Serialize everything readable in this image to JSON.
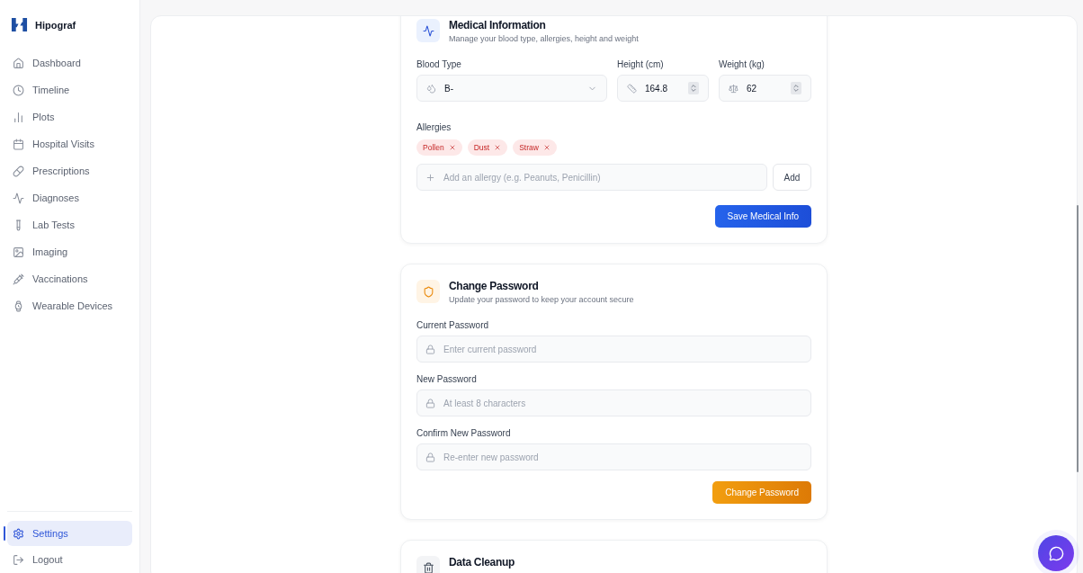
{
  "brand": {
    "name": "Hipograf"
  },
  "nav": [
    {
      "label": "Dashboard",
      "selected": false
    },
    {
      "label": "Timeline",
      "selected": false
    },
    {
      "label": "Plots",
      "selected": false
    },
    {
      "label": "Hospital Visits",
      "selected": false
    },
    {
      "label": "Prescriptions",
      "selected": false
    },
    {
      "label": "Diagnoses",
      "selected": false
    },
    {
      "label": "Lab Tests",
      "selected": false
    },
    {
      "label": "Imaging",
      "selected": false
    },
    {
      "label": "Vaccinations",
      "selected": false
    },
    {
      "label": "Wearable Devices",
      "selected": false
    }
  ],
  "nav_bottom": [
    {
      "label": "Settings",
      "selected": true
    },
    {
      "label": "Logout",
      "selected": false
    }
  ],
  "medical": {
    "title": "Medical Information",
    "subtitle": "Manage your blood type, allergies, height and weight",
    "blood_type": {
      "label": "Blood Type",
      "value": "B-"
    },
    "height": {
      "label": "Height (cm)",
      "value": "164.8"
    },
    "weight": {
      "label": "Weight (kg)",
      "value": "62"
    },
    "allergies_label": "Allergies",
    "allergies": [
      "Pollen",
      "Dust",
      "Straw"
    ],
    "allergy_input": {
      "placeholder": "Add an allergy (e.g. Peanuts, Penicillin)"
    },
    "add_button": "Add",
    "save_button": "Save Medical Info"
  },
  "password": {
    "title": "Change Password",
    "subtitle": "Update your password to keep your account secure",
    "fields": [
      {
        "label": "Current Password",
        "placeholder": "Enter current password"
      },
      {
        "label": "New Password",
        "placeholder": "At least 8 characters"
      },
      {
        "label": "Confirm New Password",
        "placeholder": "Re-enter new password"
      }
    ],
    "button": "Change Password"
  },
  "cleanup": {
    "title": "Data Cleanup"
  }
}
